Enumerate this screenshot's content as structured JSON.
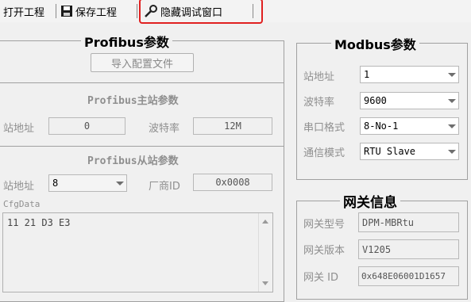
{
  "toolbar": {
    "open_label": "打开工程",
    "save_label": "保存工程",
    "hide_debug_label": "隐藏调试窗口"
  },
  "profibus": {
    "title": "Profibus参数",
    "import_button": "导入配置文件",
    "master_section": "Profibus主站参数",
    "master_address_label": "站地址",
    "master_address_value": "0",
    "baud_label": "波特率",
    "baud_value": "12M",
    "slave_section": "Profibus从站参数",
    "slave_address_label": "站地址",
    "slave_address_value": "8",
    "vendor_label": "厂商ID",
    "vendor_value": "0x0008",
    "cfg_label": "CfgData",
    "cfg_value": "11 21 D3 E3"
  },
  "modbus": {
    "title": "Modbus参数",
    "address_label": "站地址",
    "address_value": "1",
    "baud_label": "波特率",
    "baud_value": "9600",
    "serial_label": "串口格式",
    "serial_value": "8-No-1",
    "mode_label": "通信模式",
    "mode_value": "RTU Slave"
  },
  "gateway": {
    "title": "网关信息",
    "model_label": "网关型号",
    "model_value": "DPM-MBRtu",
    "version_label": "网关版本",
    "version_value": "V1205",
    "id_label": "网关 ID",
    "id_value": "0x648E06001D1657"
  },
  "colors": {
    "highlight": "#e02020"
  }
}
